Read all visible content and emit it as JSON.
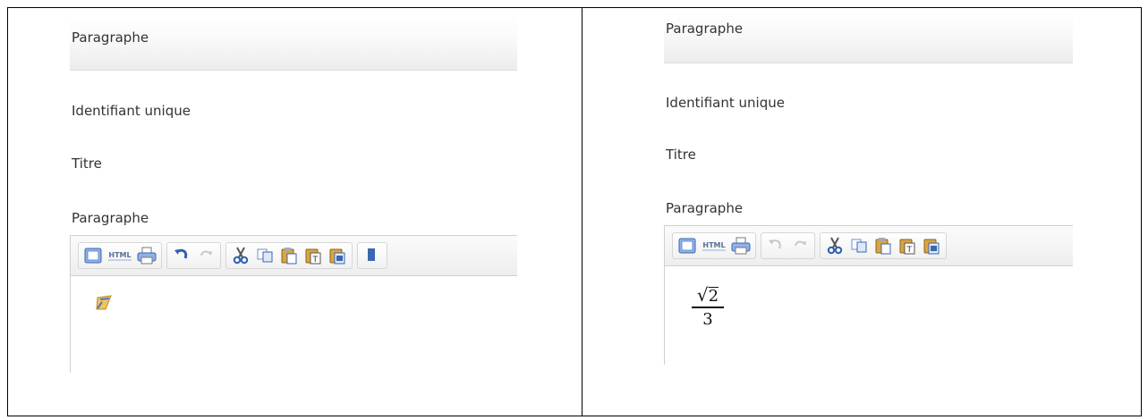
{
  "left": {
    "section_title": "Paragraphe",
    "fields": {
      "unique_id": "Identifiant unique",
      "title": "Titre",
      "paragraph": "Paragraphe"
    },
    "toolbar": {
      "html_label": "HTML",
      "buttons": [
        "source-icon",
        "html-icon",
        "print-icon",
        "undo-icon",
        "redo-icon",
        "cut-icon",
        "copy-icon",
        "paste-icon",
        "paste-text-icon",
        "paste-word-icon"
      ]
    },
    "editor_content_icon": "formula-edit-icon"
  },
  "right": {
    "section_title": "Paragraphe",
    "fields": {
      "unique_id": "Identifiant unique",
      "title": "Titre",
      "paragraph": "Paragraphe"
    },
    "toolbar": {
      "html_label": "HTML",
      "buttons": [
        "source-icon",
        "html-icon",
        "print-icon",
        "undo-icon",
        "redo-icon",
        "cut-icon",
        "copy-icon",
        "paste-icon",
        "paste-text-icon",
        "paste-word-icon"
      ]
    },
    "formula": {
      "radicand": "2",
      "denominator": "3"
    }
  },
  "colors": {
    "border": "#000000",
    "toolbar_border": "#cfcfcf",
    "icon_blue": "#4a78c2",
    "icon_orange": "#e8a23a"
  }
}
